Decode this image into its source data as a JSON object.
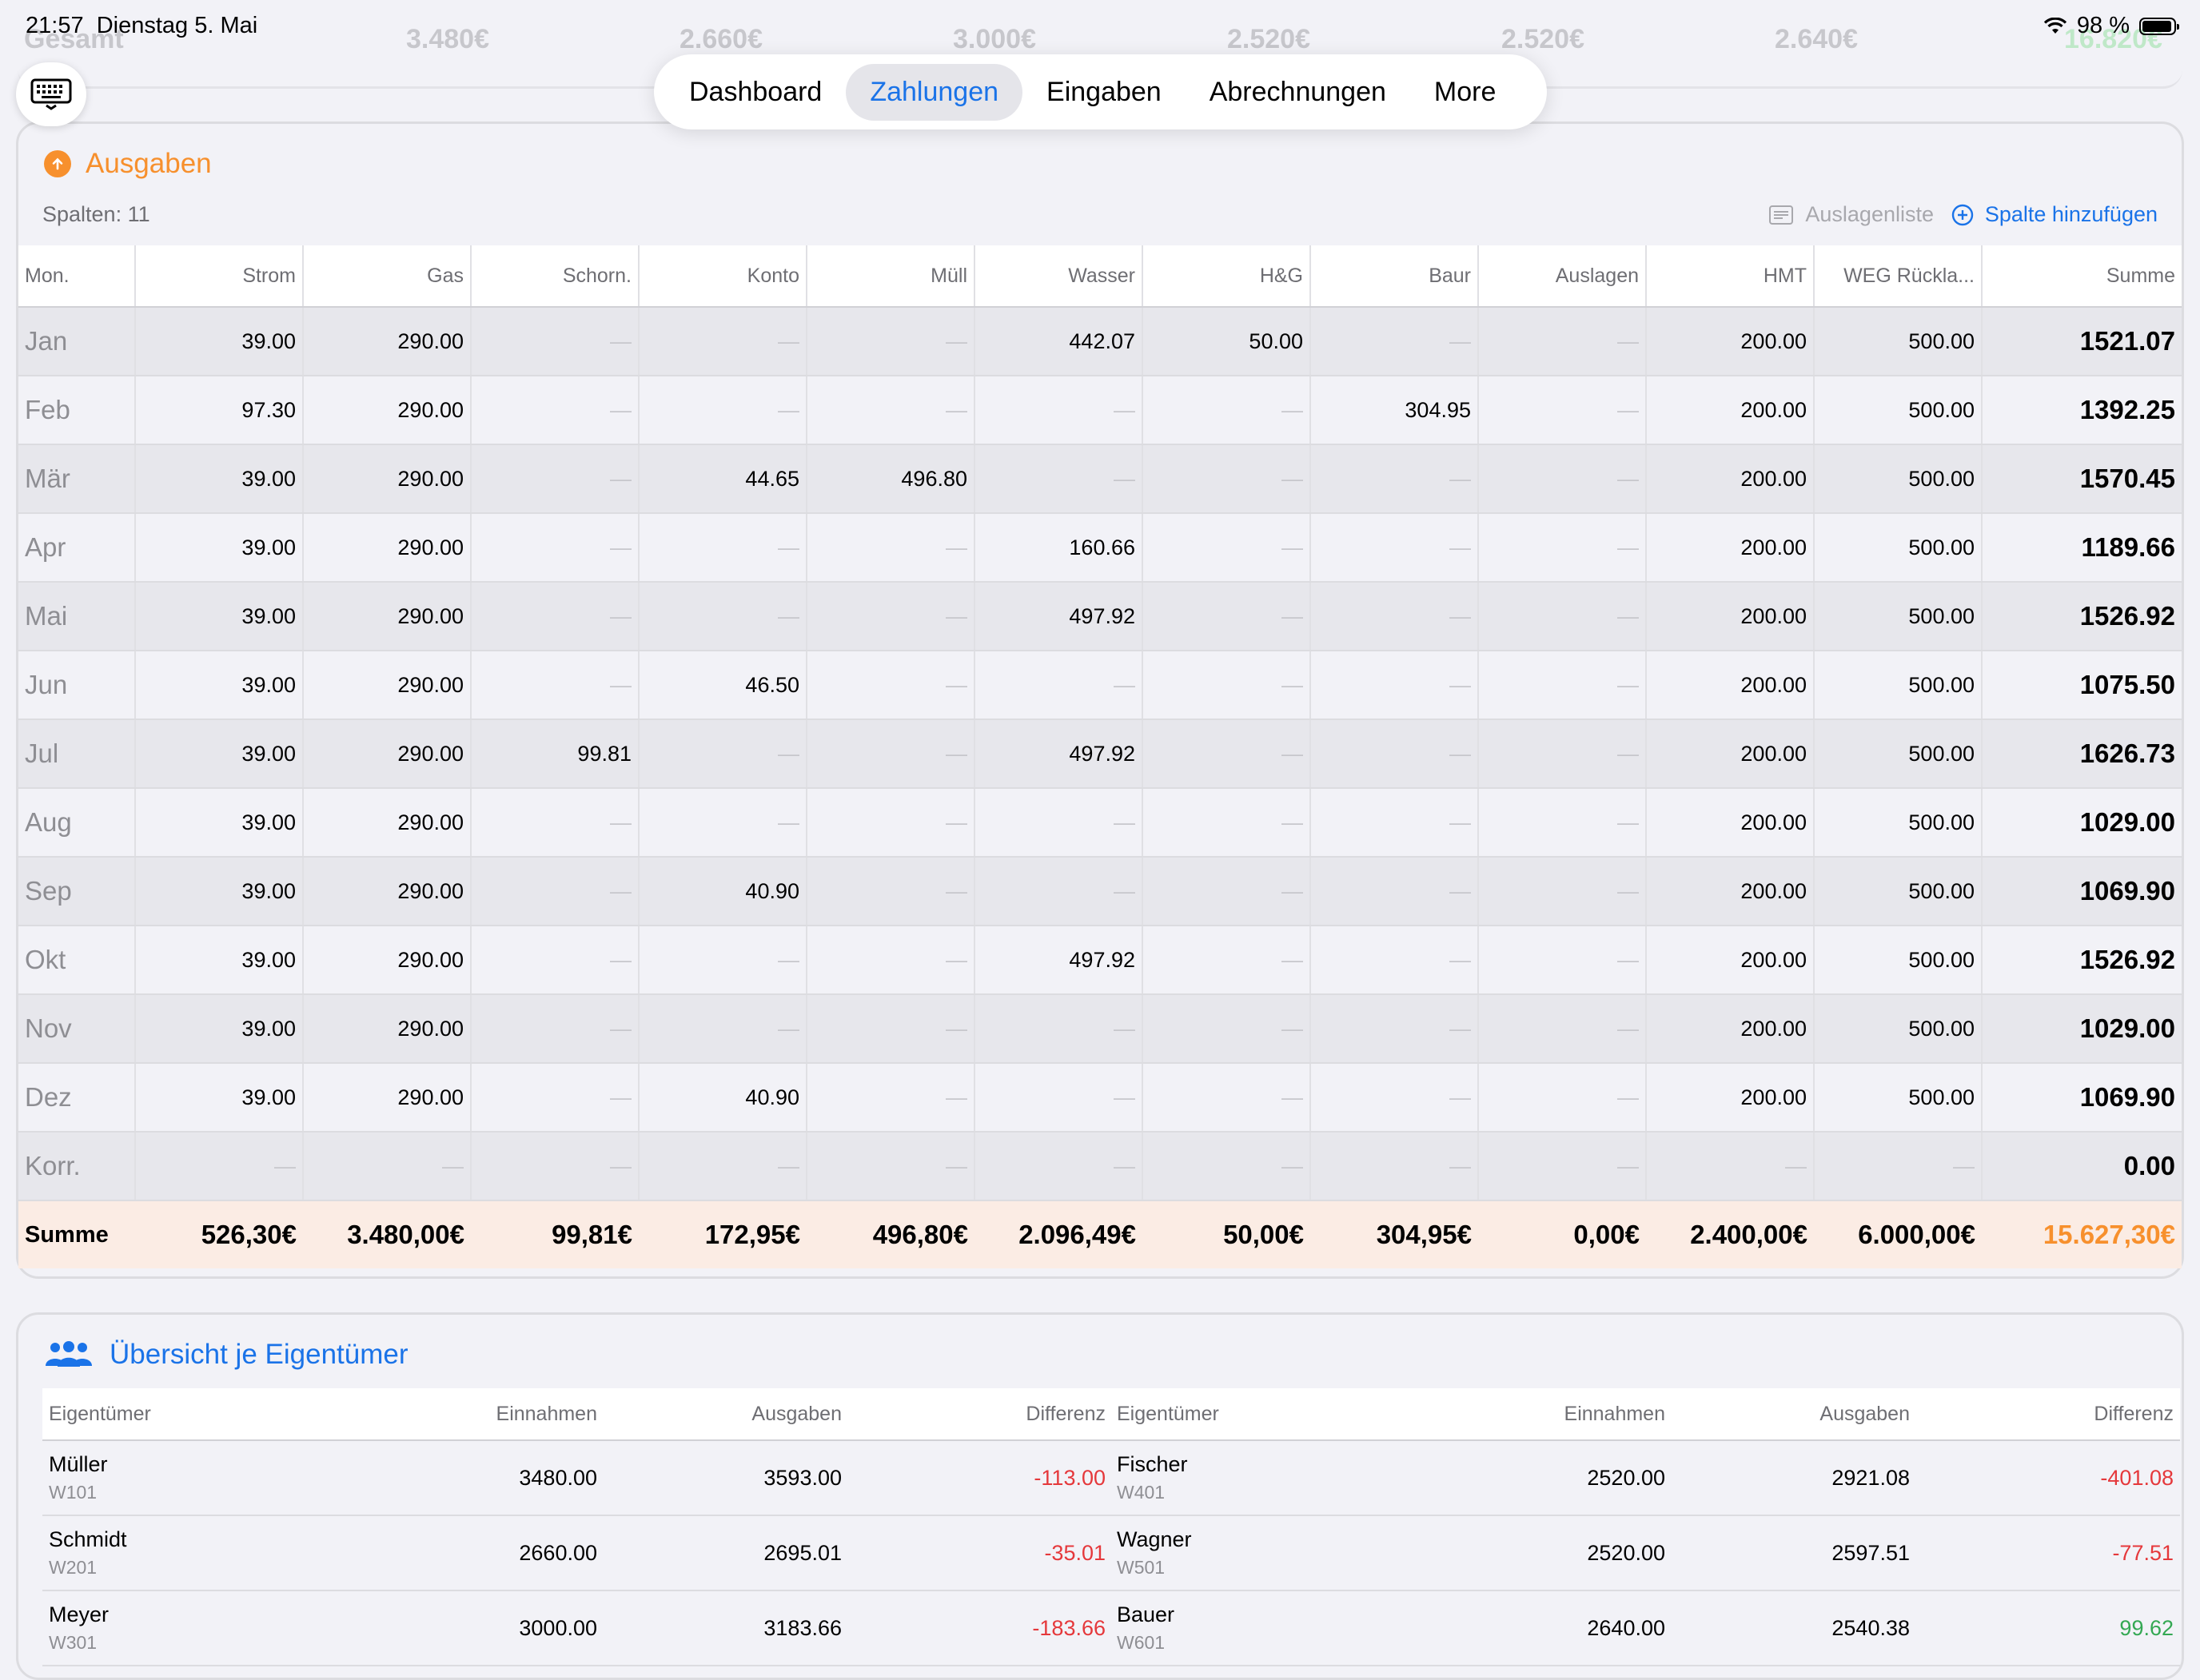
{
  "status": {
    "time": "21:57",
    "date": "Dienstag 5. Mai",
    "battery": "98 %"
  },
  "ghost": {
    "label": "Gesamt",
    "values": [
      "3.480€",
      "2.660€",
      "3.000€",
      "2.520€",
      "2.520€",
      "2.640€",
      "16.820€"
    ]
  },
  "tabs": [
    {
      "label": "Dashboard",
      "active": false
    },
    {
      "label": "Zahlungen",
      "active": true
    },
    {
      "label": "Eingaben",
      "active": false
    },
    {
      "label": "Abrechnungen",
      "active": false
    },
    {
      "label": "More",
      "active": false
    }
  ],
  "expenses": {
    "title": "Ausgaben",
    "columns_info": "Spalten: 11",
    "auslagen_link": "Auslagenliste",
    "add_column": "Spalte hinzufügen",
    "headers": [
      "Mon.",
      "Strom",
      "Gas",
      "Schorn.",
      "Konto",
      "Müll",
      "Wasser",
      "H&G",
      "Baur",
      "Auslagen",
      "HMT",
      "WEG Rückla...",
      "Summe"
    ],
    "rows": [
      [
        "Jan",
        "39.00",
        "290.00",
        "—",
        "—",
        "—",
        "442.07",
        "50.00",
        "—",
        "—",
        "200.00",
        "500.00",
        "1521.07"
      ],
      [
        "Feb",
        "97.30",
        "290.00",
        "—",
        "—",
        "—",
        "—",
        "—",
        "304.95",
        "—",
        "200.00",
        "500.00",
        "1392.25"
      ],
      [
        "Mär",
        "39.00",
        "290.00",
        "—",
        "44.65",
        "496.80",
        "—",
        "—",
        "—",
        "—",
        "200.00",
        "500.00",
        "1570.45"
      ],
      [
        "Apr",
        "39.00",
        "290.00",
        "—",
        "—",
        "—",
        "160.66",
        "—",
        "—",
        "—",
        "200.00",
        "500.00",
        "1189.66"
      ],
      [
        "Mai",
        "39.00",
        "290.00",
        "—",
        "—",
        "—",
        "497.92",
        "—",
        "—",
        "—",
        "200.00",
        "500.00",
        "1526.92"
      ],
      [
        "Jun",
        "39.00",
        "290.00",
        "—",
        "46.50",
        "—",
        "—",
        "—",
        "—",
        "—",
        "200.00",
        "500.00",
        "1075.50"
      ],
      [
        "Jul",
        "39.00",
        "290.00",
        "99.81",
        "—",
        "—",
        "497.92",
        "—",
        "—",
        "—",
        "200.00",
        "500.00",
        "1626.73"
      ],
      [
        "Aug",
        "39.00",
        "290.00",
        "—",
        "—",
        "—",
        "—",
        "—",
        "—",
        "—",
        "200.00",
        "500.00",
        "1029.00"
      ],
      [
        "Sep",
        "39.00",
        "290.00",
        "—",
        "40.90",
        "—",
        "—",
        "—",
        "—",
        "—",
        "200.00",
        "500.00",
        "1069.90"
      ],
      [
        "Okt",
        "39.00",
        "290.00",
        "—",
        "—",
        "—",
        "497.92",
        "—",
        "—",
        "—",
        "200.00",
        "500.00",
        "1526.92"
      ],
      [
        "Nov",
        "39.00",
        "290.00",
        "—",
        "—",
        "—",
        "—",
        "—",
        "—",
        "—",
        "200.00",
        "500.00",
        "1029.00"
      ],
      [
        "Dez",
        "39.00",
        "290.00",
        "—",
        "40.90",
        "—",
        "—",
        "—",
        "—",
        "—",
        "200.00",
        "500.00",
        "1069.90"
      ],
      [
        "Korr.",
        "—",
        "—",
        "—",
        "—",
        "—",
        "—",
        "—",
        "—",
        "—",
        "—",
        "—",
        "0.00"
      ]
    ],
    "totals": [
      "Summe",
      "526,30€",
      "3.480,00€",
      "99,81€",
      "172,95€",
      "496,80€",
      "2.096,49€",
      "50,00€",
      "304,95€",
      "0,00€",
      "2.400,00€",
      "6.000,00€",
      "15.627,30€"
    ]
  },
  "owners": {
    "title": "Übersicht je Eigentümer",
    "headers": [
      "Eigentümer",
      "Einnahmen",
      "Ausgaben",
      "Differenz"
    ],
    "left": [
      {
        "name": "Müller",
        "unit": "W101",
        "income": "3480.00",
        "expense": "3593.00",
        "diff": "-113.00",
        "sign": "neg"
      },
      {
        "name": "Schmidt",
        "unit": "W201",
        "income": "2660.00",
        "expense": "2695.01",
        "diff": "-35.01",
        "sign": "neg"
      },
      {
        "name": "Meyer",
        "unit": "W301",
        "income": "3000.00",
        "expense": "3183.66",
        "diff": "-183.66",
        "sign": "neg"
      }
    ],
    "right": [
      {
        "name": "Fischer",
        "unit": "W401",
        "income": "2520.00",
        "expense": "2921.08",
        "diff": "-401.08",
        "sign": "neg"
      },
      {
        "name": "Wagner",
        "unit": "W501",
        "income": "2520.00",
        "expense": "2597.51",
        "diff": "-77.51",
        "sign": "neg"
      },
      {
        "name": "Bauer",
        "unit": "W601",
        "income": "2640.00",
        "expense": "2540.38",
        "diff": "99.62",
        "sign": "pos"
      }
    ]
  }
}
